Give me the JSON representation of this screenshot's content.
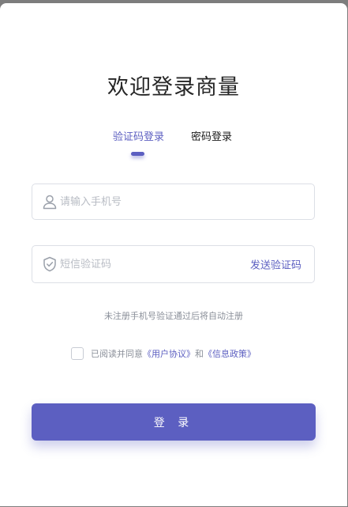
{
  "title": "欢迎登录商量",
  "tabs": [
    {
      "label": "验证码登录",
      "active": true
    },
    {
      "label": "密码登录",
      "active": false
    }
  ],
  "phone_field": {
    "placeholder": "请输入手机号",
    "value": "",
    "icon": "user-icon"
  },
  "code_field": {
    "placeholder": "短信验证码",
    "value": "",
    "icon": "shield-check-icon",
    "send_label": "发送验证码"
  },
  "hint": "未注册手机号验证通过后将自动注册",
  "agreement": {
    "checked": false,
    "prefix": "已阅读并同意",
    "terms": "《用户协议》",
    "and": "和",
    "privacy": "《信息政策》"
  },
  "login_button": "登 录",
  "colors": {
    "accent": "#5c5fc1",
    "backdrop": "#7d7d7d",
    "card": "#ffffff"
  }
}
